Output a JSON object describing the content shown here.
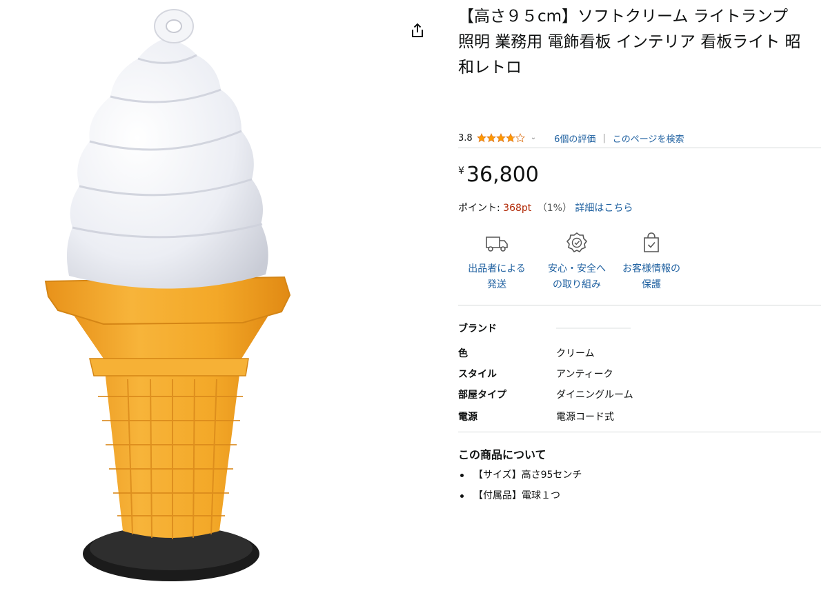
{
  "product": {
    "title": "【高さ９５cm】ソフトクリーム ライトランプ 照明 業務用 電飾看板 インテリア 看板ライト 昭和レトロ",
    "rating": {
      "value": "3.8",
      "stars": 3.8,
      "count_label": "6個の評価",
      "separator": "|",
      "search_label": "このページを検索"
    },
    "price": {
      "currency": "¥",
      "amount": "36,800"
    },
    "points": {
      "label": "ポイント:",
      "value": "368pt",
      "percent": "（1%）",
      "details_link": "詳細はこちら"
    },
    "features": [
      {
        "icon": "delivery-truck-icon",
        "line1": "出品者による",
        "line2": "発送"
      },
      {
        "icon": "security-badge-icon",
        "line1": "安心・安全へ",
        "line2": "の取り組み"
      },
      {
        "icon": "privacy-bag-icon",
        "line1": "お客様情報の",
        "line2": "保護"
      }
    ],
    "specs": [
      {
        "key": "ブランド",
        "value": ""
      },
      {
        "key": "色",
        "value": "クリーム"
      },
      {
        "key": "スタイル",
        "value": "アンティーク"
      },
      {
        "key": "部屋タイプ",
        "value": "ダイニングルーム"
      },
      {
        "key": "電源",
        "value": "電源コード式"
      }
    ],
    "about": {
      "heading": "この商品について",
      "bullets": [
        "【サイズ】高さ95センチ",
        "【付属品】電球１つ"
      ]
    }
  },
  "icons": {
    "share": "share-icon",
    "rating_dropdown": "chevron-down-icon"
  },
  "colors": {
    "link": "#2162a1",
    "star": "#ff9900",
    "points": "#b12704",
    "cone": "#f1a826",
    "cream": "#f2f3f7",
    "base": "#222222"
  }
}
